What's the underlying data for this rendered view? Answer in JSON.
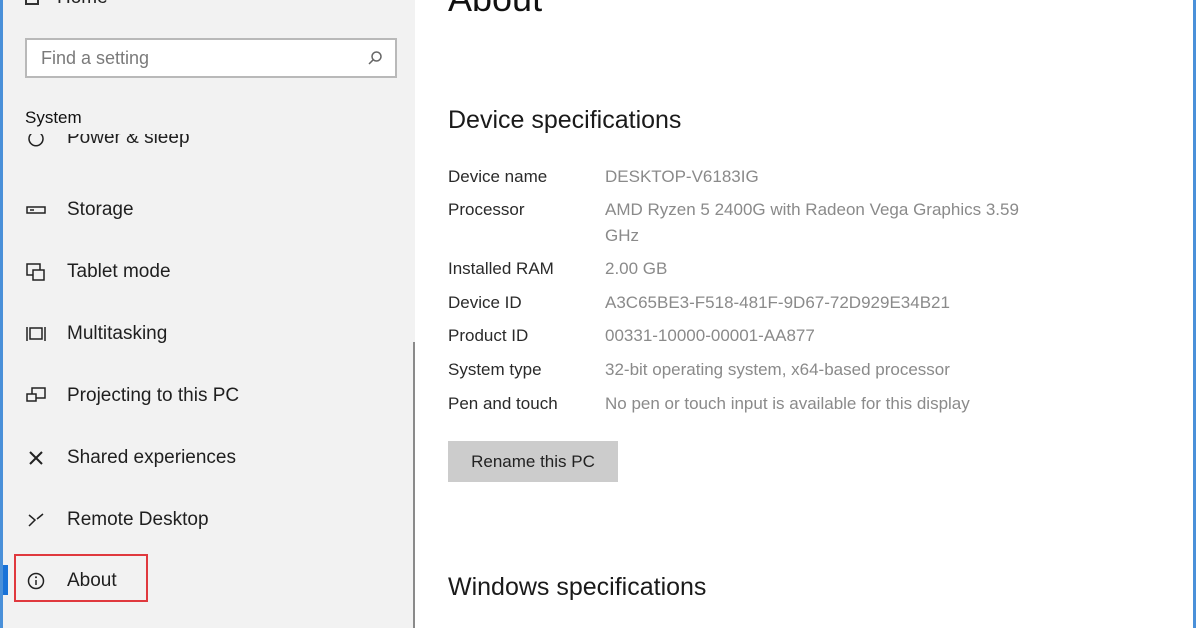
{
  "sidebar": {
    "home_label": "Home",
    "search_placeholder": "Find a setting",
    "section_label": "System",
    "items": [
      {
        "label": "Power & sleep",
        "icon": "power-icon"
      },
      {
        "label": "Storage",
        "icon": "storage-icon"
      },
      {
        "label": "Tablet mode",
        "icon": "tablet-mode-icon"
      },
      {
        "label": "Multitasking",
        "icon": "multitasking-icon"
      },
      {
        "label": "Projecting to this PC",
        "icon": "projecting-icon"
      },
      {
        "label": "Shared experiences",
        "icon": "shared-experiences-icon"
      },
      {
        "label": "Remote Desktop",
        "icon": "remote-desktop-icon"
      },
      {
        "label": "About",
        "icon": "info-icon",
        "selected": true
      }
    ]
  },
  "main": {
    "title": "About",
    "device_specs": {
      "heading": "Device specifications",
      "rows": [
        {
          "label": "Device name",
          "value": "DESKTOP-V6183IG"
        },
        {
          "label": "Processor",
          "value": "AMD Ryzen 5 2400G with Radeon Vega Graphics 3.59 GHz"
        },
        {
          "label": "Installed RAM",
          "value": "2.00 GB"
        },
        {
          "label": "Device ID",
          "value": "A3C65BE3-F518-481F-9D67-72D929E34B21"
        },
        {
          "label": "Product ID",
          "value": "00331-10000-00001-AA877"
        },
        {
          "label": "System type",
          "value": "32-bit operating system, x64-based processor"
        },
        {
          "label": "Pen and touch",
          "value": "No pen or touch input is available for this display"
        }
      ]
    },
    "rename_button": "Rename this PC",
    "windows_specs": {
      "heading": "Windows specifications"
    }
  },
  "colors": {
    "sidebar_bg": "#f2f2f2",
    "accent": "#1a73d8",
    "highlight_box": "#e0393e",
    "button_bg": "#cccccc",
    "value_text": "#8a8a8a"
  }
}
